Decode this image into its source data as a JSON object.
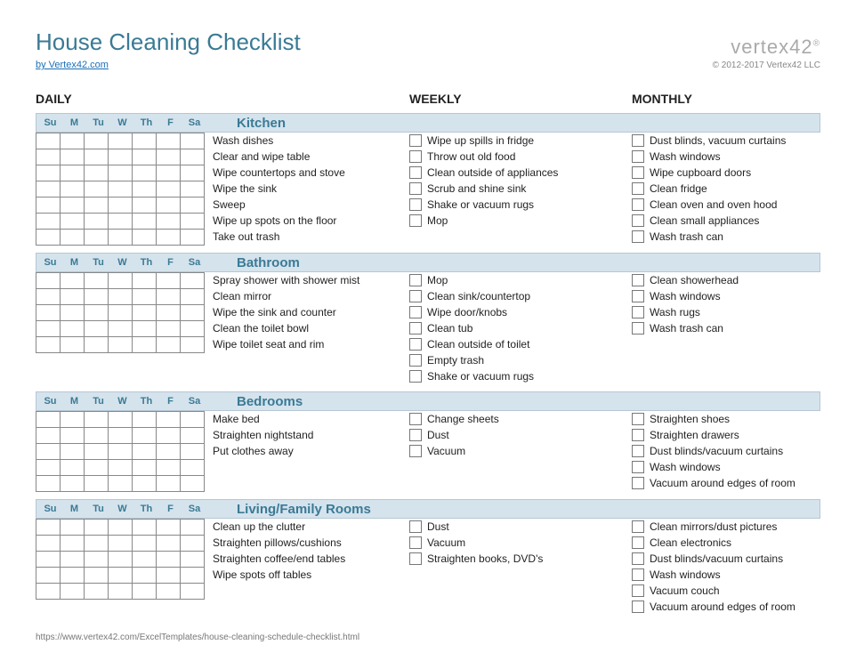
{
  "title": "House Cleaning Checklist",
  "by_link": "by Vertex42.com",
  "logo": "vertex42",
  "copyright": "© 2012-2017 Vertex42 LLC",
  "col_headers": {
    "daily": "DAILY",
    "weekly": "WEEKLY",
    "monthly": "MONTHLY"
  },
  "day_abbrev": [
    "Su",
    "M",
    "Tu",
    "W",
    "Th",
    "F",
    "Sa"
  ],
  "sections": [
    {
      "name": "Kitchen",
      "daily_rows": 7,
      "daily": [
        "Wash dishes",
        "Clear and wipe table",
        "Wipe countertops and stove",
        "Wipe the sink",
        "Sweep",
        "Wipe up spots on the floor",
        "Take out trash"
      ],
      "weekly": [
        "Wipe up spills in fridge",
        "Throw out old food",
        "Clean outside of appliances",
        "Scrub and shine sink",
        "Shake or vacuum rugs",
        "Mop"
      ],
      "monthly": [
        "Dust blinds, vacuum curtains",
        "Wash windows",
        "Wipe cupboard doors",
        "Clean fridge",
        "Clean oven and oven hood",
        "Clean small appliances",
        "Wash trash can"
      ]
    },
    {
      "name": "Bathroom",
      "daily_rows": 5,
      "daily": [
        "Spray shower with shower mist",
        "Clean mirror",
        "Wipe the sink and counter",
        "Clean the toilet bowl",
        "Wipe toilet seat and rim"
      ],
      "weekly": [
        "Mop",
        "Clean sink/countertop",
        "Wipe door/knobs",
        "Clean tub",
        "Clean outside of toilet",
        "Empty trash",
        "Shake or vacuum rugs"
      ],
      "monthly": [
        "Clean showerhead",
        "Wash windows",
        "Wash rugs",
        "Wash trash can"
      ]
    },
    {
      "name": "Bedrooms",
      "daily_rows": 5,
      "daily": [
        "Make bed",
        "Straighten nightstand",
        "Put clothes away"
      ],
      "weekly": [
        "Change sheets",
        "Dust",
        "Vacuum"
      ],
      "monthly": [
        "Straighten shoes",
        "Straighten drawers",
        "Dust blinds/vacuum curtains",
        "Wash windows",
        "Vacuum around edges of room"
      ]
    },
    {
      "name": "Living/Family Rooms",
      "daily_rows": 5,
      "daily": [
        "Clean up the clutter",
        "Straighten pillows/cushions",
        "Straighten coffee/end tables",
        "Wipe spots off tables"
      ],
      "weekly": [
        "Dust",
        "Vacuum",
        "Straighten books, DVD's"
      ],
      "monthly": [
        "Clean mirrors/dust pictures",
        "Clean electronics",
        "Dust blinds/vacuum curtains",
        "Wash windows",
        "Vacuum couch",
        "Vacuum around edges of room"
      ]
    }
  ],
  "footer_url": "https://www.vertex42.com/ExcelTemplates/house-cleaning-schedule-checklist.html"
}
